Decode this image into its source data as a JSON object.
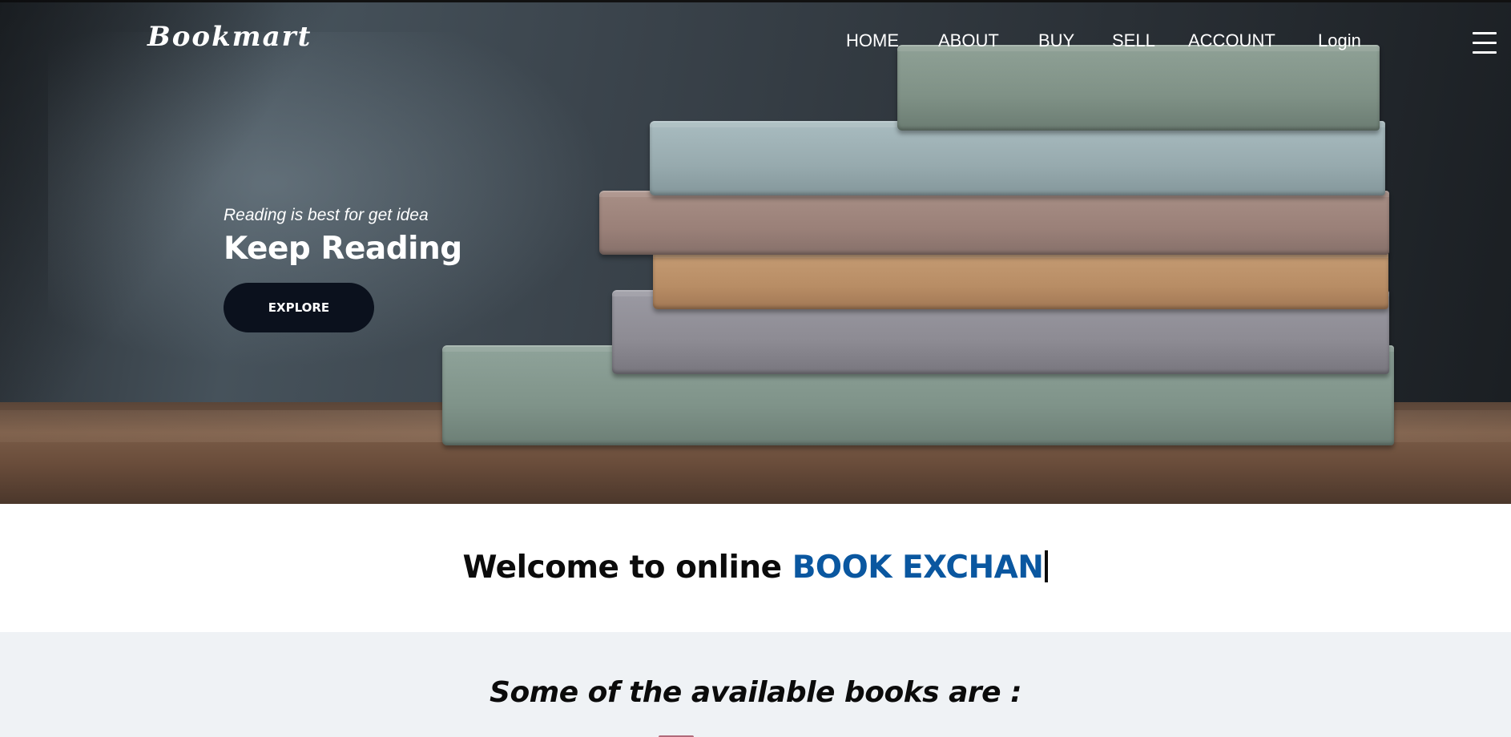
{
  "header": {
    "logo": "Bookmart",
    "nav": [
      {
        "id": "home",
        "label": "HOME"
      },
      {
        "id": "about",
        "label": "ABOUT"
      },
      {
        "id": "buy",
        "label": "BUY"
      },
      {
        "id": "sell",
        "label": "SELL"
      },
      {
        "id": "account",
        "label": "ACCOUNT"
      },
      {
        "id": "login",
        "label": "Login"
      }
    ],
    "menu_icon": "hamburger-menu-icon"
  },
  "hero": {
    "tagline": "Reading is best for get idea",
    "title": "Keep Reading",
    "cta_label": "EXPLORE",
    "image": "stacked-books-photo"
  },
  "welcome": {
    "text_prefix": "Welcome to online ",
    "text_highlight": "BOOK EXCHAN",
    "highlight_color": "#0a57a0"
  },
  "available": {
    "title": "Some of the available books are :"
  },
  "colors": {
    "button_bg": "#0b111d",
    "section_bg": "#eff2f5"
  }
}
